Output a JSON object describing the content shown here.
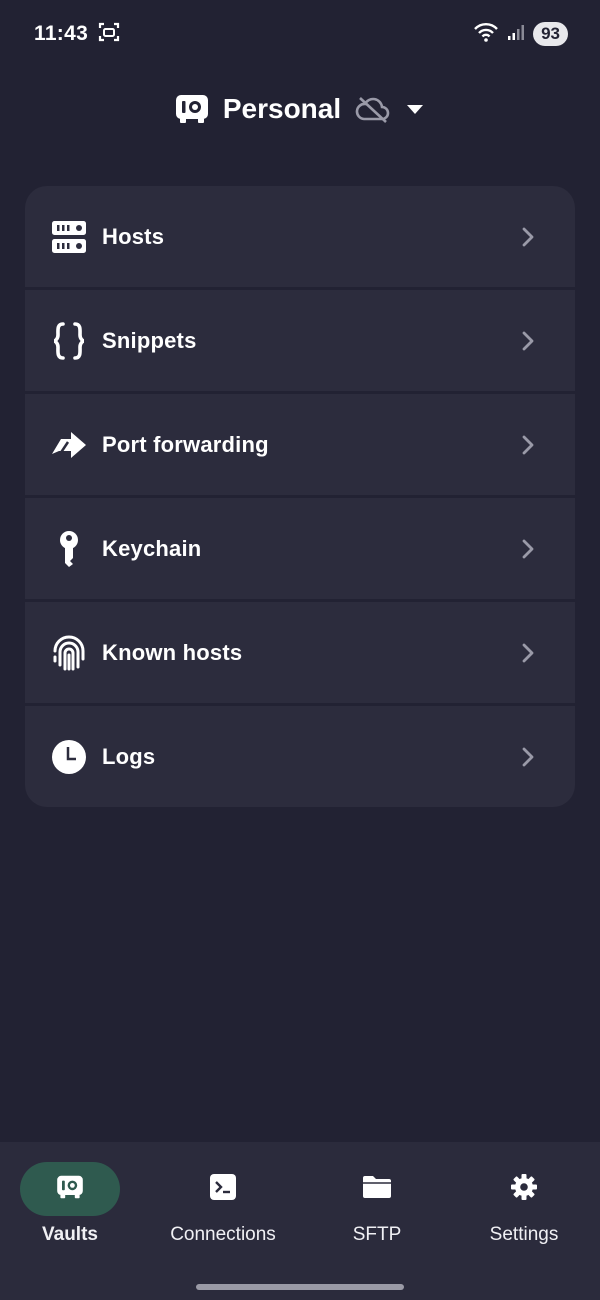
{
  "status_bar": {
    "time": "11:43",
    "battery": "93",
    "icons": [
      "screenshot-icon",
      "wifi-icon",
      "signal-icon",
      "battery-icon"
    ]
  },
  "header": {
    "vault_name": "Personal",
    "vault_icon": "vault-icon",
    "sync_icon": "cloud-off-icon",
    "dropdown_icon": "caret-down-icon"
  },
  "menu": {
    "items": [
      {
        "label": "Hosts",
        "icon": "server-icon"
      },
      {
        "label": "Snippets",
        "icon": "braces-icon"
      },
      {
        "label": "Port forwarding",
        "icon": "forward-arrow-icon"
      },
      {
        "label": "Keychain",
        "icon": "key-icon"
      },
      {
        "label": "Known hosts",
        "icon": "fingerprint-icon"
      },
      {
        "label": "Logs",
        "icon": "clock-icon"
      }
    ]
  },
  "bottom_nav": {
    "items": [
      {
        "label": "Vaults",
        "icon": "vault-icon",
        "active": true
      },
      {
        "label": "Connections",
        "icon": "terminal-icon",
        "active": false
      },
      {
        "label": "SFTP",
        "icon": "folder-icon",
        "active": false
      },
      {
        "label": "Settings",
        "icon": "gear-icon",
        "active": false
      }
    ]
  },
  "colors": {
    "background": "#222233",
    "card": "#2c2c3d",
    "nav_background": "#2b2b3c",
    "active_pill": "#2f5a4f",
    "chevron": "#9a9aa8"
  }
}
